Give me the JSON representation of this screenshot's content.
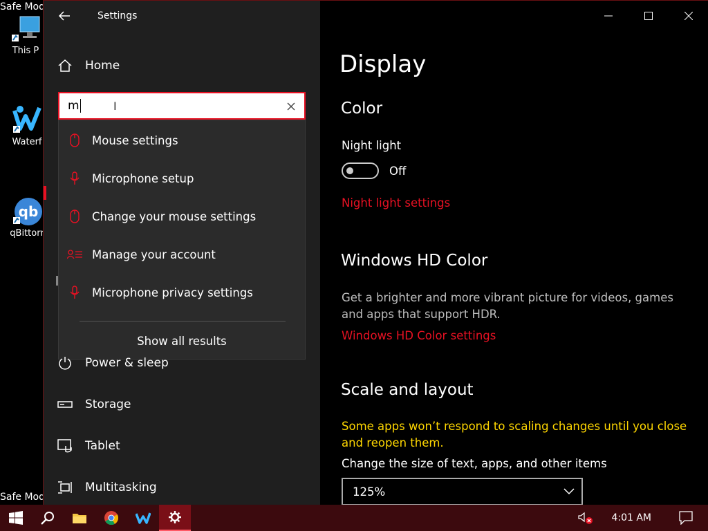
{
  "desktop": {
    "safe_mode_top": "Safe Mod",
    "safe_mode_bottom": "Safe Mod",
    "icons": [
      {
        "label": "This P",
        "icon": "computer-icon"
      },
      {
        "label": "Waterf",
        "icon": "waterfox-icon"
      },
      {
        "label": "qBittorr",
        "icon": "qbittorrent-icon"
      }
    ]
  },
  "window": {
    "title": "Settings",
    "controls": {
      "minimize": "minimize-icon",
      "maximize": "maximize-icon",
      "close": "close-icon"
    }
  },
  "sidebar": {
    "home_label": "Home",
    "search": {
      "value": "m",
      "placeholder": ""
    },
    "suggestions": [
      {
        "label": "Mouse settings",
        "icon": "mouse-icon"
      },
      {
        "label": "Microphone setup",
        "icon": "microphone-icon"
      },
      {
        "label": "Change your mouse settings",
        "icon": "mouse-icon"
      },
      {
        "label": "Manage your account",
        "icon": "account-icon"
      },
      {
        "label": "Microphone privacy settings",
        "icon": "microphone-icon"
      }
    ],
    "show_all": "Show all results",
    "nav": [
      {
        "label": "Power & sleep",
        "icon": "power-icon"
      },
      {
        "label": "Storage",
        "icon": "storage-icon"
      },
      {
        "label": "Tablet",
        "icon": "tablet-icon"
      },
      {
        "label": "Multitasking",
        "icon": "multitasking-icon"
      }
    ]
  },
  "content": {
    "title": "Display",
    "color": {
      "heading": "Color",
      "night_light_label": "Night light",
      "toggle_state": "Off",
      "night_light_link": "Night light settings"
    },
    "hd_color": {
      "heading": "Windows HD Color",
      "description": "Get a brighter and more vibrant picture for videos, games and apps that support HDR.",
      "link": "Windows HD Color settings"
    },
    "scale": {
      "heading": "Scale and layout",
      "warning": "Some apps won’t respond to scaling changes until you close and reopen them.",
      "size_label": "Change the size of text, apps, and other items",
      "size_value": "125%"
    }
  },
  "taskbar": {
    "clock": "4:01 AM",
    "apps": [
      "windows-start-icon",
      "search-icon",
      "file-explorer-icon",
      "chrome-icon",
      "waterfox-icon",
      "settings-gear-icon"
    ]
  },
  "colors": {
    "accent": "#e81123",
    "warning": "#ffd700",
    "taskbar": "#3c0a0e",
    "sidebar": "#1f1f1f"
  }
}
